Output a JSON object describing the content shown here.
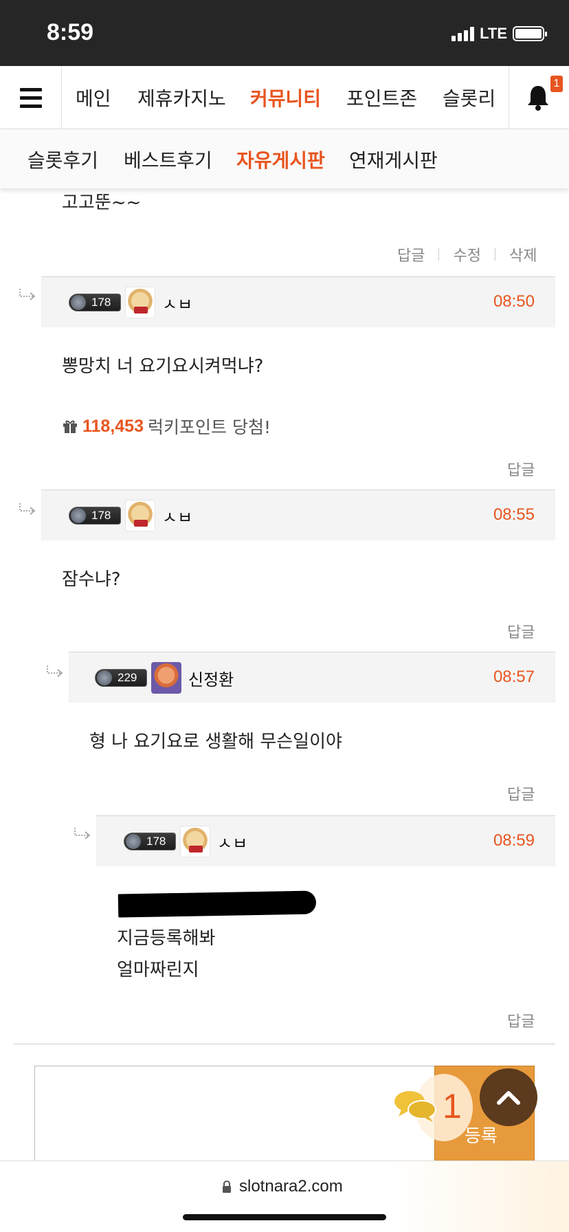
{
  "status_bar": {
    "time": "8:59",
    "network": "LTE"
  },
  "main_nav": {
    "items": [
      "메인",
      "제휴카지노",
      "커뮤니티",
      "포인트존",
      "슬롯리"
    ],
    "active": "커뮤니티",
    "notification_count": "1"
  },
  "sub_nav": {
    "items": [
      "슬롯후기",
      "베스트후기",
      "자유게시판",
      "연재게시판"
    ],
    "active": "자유게시판"
  },
  "comments": [
    {
      "body": "고고뚠~~",
      "actions": [
        "답글",
        "수정",
        "삭제"
      ]
    },
    {
      "level": "178",
      "author": "ㅅㅂ",
      "time": "08:50",
      "body": "뽕망치 너 요기요시켜먹냐?",
      "gift_amount": "118,453",
      "gift_text": "럭키포인트 당첨!",
      "actions": [
        "답글"
      ]
    },
    {
      "level": "178",
      "author": "ㅅㅂ",
      "time": "08:55",
      "body": "잠수냐?",
      "actions": [
        "답글"
      ]
    },
    {
      "level": "229",
      "author": "신정환",
      "time": "08:57",
      "body": "형 나 요기요로 생활해 무슨일이야",
      "actions": [
        "답글"
      ]
    },
    {
      "level": "178",
      "author": "ㅅㅂ",
      "time": "08:59",
      "body_lines": [
        "지금등록해봐",
        "얼마짜린지"
      ],
      "actions": [
        "답글"
      ]
    }
  ],
  "comment_form": {
    "submit_label": "등록",
    "comment_count": "1"
  },
  "url_bar": {
    "domain": "slotnara2.com"
  },
  "colors": {
    "accent": "#e8551f",
    "submit": "#e79a3b",
    "scroll_top": "#5b3a1e"
  },
  "icons": [
    "menu-icon",
    "bell-icon",
    "reply-arrow-icon",
    "gift-icon",
    "lock-icon",
    "chat-bubble-icon",
    "chevron-up-icon"
  ]
}
